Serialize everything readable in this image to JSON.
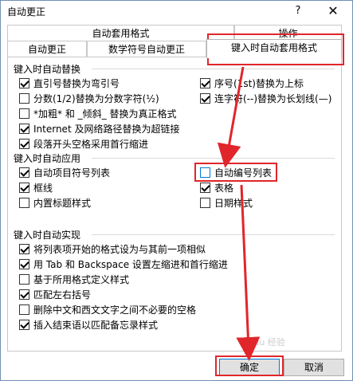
{
  "window": {
    "title": "自动更正",
    "help": "?",
    "close": "✕"
  },
  "tabs": {
    "back": [
      "自动套用格式",
      "操作"
    ],
    "front": [
      "自动更正",
      "数学符号自动更正",
      "键入时自动套用格式"
    ],
    "active": "键入时自动套用格式"
  },
  "groups": {
    "replace": {
      "title": "键入时自动替换",
      "left": [
        {
          "label": "直引号替换为弯引号",
          "checked": true
        },
        {
          "label": "分数(1/2)替换为分数字符(½)",
          "checked": false
        },
        {
          "label": "*加粗* 和 _倾斜_ 替换为真正格式",
          "checked": false
        },
        {
          "label": "Internet 及网络路径替换为超链接",
          "checked": true
        },
        {
          "label": "段落开头空格采用首行缩进",
          "checked": true
        }
      ],
      "right": [
        {
          "label": "序号(1st)替换为上标",
          "checked": true
        },
        {
          "label": "连字符(--)替换为长划线(—)",
          "checked": true
        }
      ]
    },
    "apply": {
      "title": "键入时自动应用",
      "left": [
        {
          "label": "自动项目符号列表",
          "checked": true
        },
        {
          "label": "框线",
          "checked": true
        },
        {
          "label": "内置标题样式",
          "checked": false
        }
      ],
      "right": [
        {
          "label": "自动编号列表",
          "checked": false
        },
        {
          "label": "表格",
          "checked": true
        },
        {
          "label": "日期样式",
          "checked": false
        }
      ]
    },
    "realize": {
      "title": "键入时自动实现",
      "items": [
        {
          "label": "将列表项开始的格式设为与其前一项相似",
          "checked": true
        },
        {
          "label": "用 Tab 和 Backspace 设置左缩进和首行缩进",
          "checked": true
        },
        {
          "label": "基于所用格式定义样式",
          "checked": false
        },
        {
          "label": "匹配左右括号",
          "checked": true
        },
        {
          "label": "删除中文和西文文字之间不必要的空格",
          "checked": false
        },
        {
          "label": "插入结束语以匹配备忘录样式",
          "checked": true
        }
      ]
    }
  },
  "buttons": {
    "ok": "确定",
    "cancel": "取消"
  },
  "accent": {
    "annotation": "#e0262b",
    "focus": "#0078d7"
  },
  "watermark": "Baidu 经验"
}
